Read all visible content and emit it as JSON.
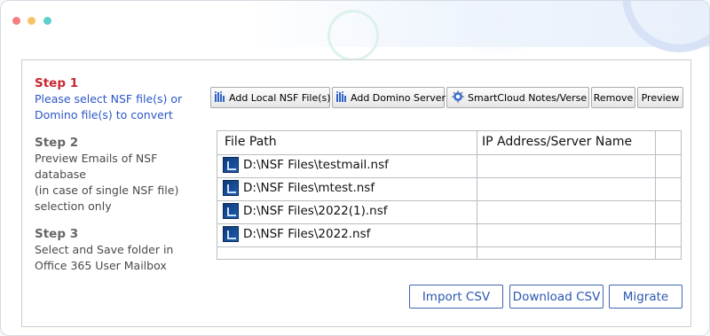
{
  "window": {
    "controls": [
      "close",
      "minimize",
      "maximize"
    ]
  },
  "steps": {
    "step1": {
      "title": "Step 1",
      "desc_lines": [
        "Please select NSF file(s) or",
        "Domino file(s) to convert"
      ]
    },
    "step2": {
      "title": "Step 2",
      "desc_lines": [
        "Preview Emails of NSF database",
        "(in case of single NSF file)",
        "selection only"
      ]
    },
    "step3": {
      "title": "Step 3",
      "desc_lines": [
        "Select and Save folder in",
        "Office 365 User Mailbox"
      ]
    }
  },
  "toolbar": {
    "add_local": "Add Local NSF File(s)",
    "add_domino": "Add Domino Server",
    "smartcloud": "SmartCloud Notes/Verse",
    "remove": "Remove",
    "preview": "Preview"
  },
  "grid": {
    "headers": {
      "file_path": "File Path",
      "ip_address": "IP Address/Server Name"
    },
    "rows": [
      {
        "file_path": "D:\\NSF Files\\testmail.nsf",
        "ip_address": ""
      },
      {
        "file_path": "D:\\NSF Files\\mtest.nsf",
        "ip_address": ""
      },
      {
        "file_path": "D:\\NSF Files\\2022(1).nsf",
        "ip_address": ""
      },
      {
        "file_path": "D:\\NSF Files\\2022.nsf",
        "ip_address": ""
      }
    ]
  },
  "actions": {
    "import_csv": "Import CSV",
    "download_csv": "Download CSV",
    "migrate": "Migrate"
  },
  "colors": {
    "step_active": "#c8272e",
    "step_active_desc": "#2a56c6",
    "button_border": "#3f66b0"
  }
}
